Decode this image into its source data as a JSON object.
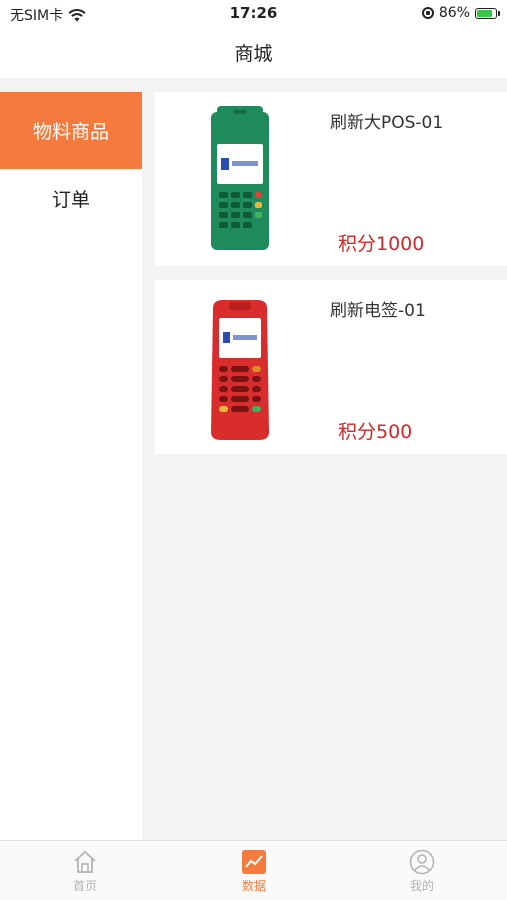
{
  "status_bar": {
    "carrier": "无SIM卡",
    "time": "17:26",
    "battery": "86%",
    "battery_level": 0.86,
    "icons": [
      "wifi-icon",
      "orientation-lock-icon",
      "battery-charging-icon"
    ]
  },
  "nav": {
    "title": "商城"
  },
  "sidebar": {
    "items": [
      {
        "label": "物料商品",
        "active": true
      },
      {
        "label": "订单",
        "active": false
      }
    ]
  },
  "products": [
    {
      "name": "刷新大POS-01",
      "price": "积分1000",
      "image": "green-pos-terminal"
    },
    {
      "name": "刷新电签-01",
      "price": "积分500",
      "image": "red-pos-terminal"
    }
  ],
  "tab_bar": {
    "tabs": [
      {
        "label": "首页",
        "icon": "home-icon",
        "active": false
      },
      {
        "label": "数据",
        "icon": "chart-icon",
        "active": true
      },
      {
        "label": "我的",
        "icon": "user-icon",
        "active": false
      }
    ]
  },
  "colors": {
    "accent": "#f47b3d",
    "price": "#d62626",
    "background": "#f4f4f4"
  }
}
